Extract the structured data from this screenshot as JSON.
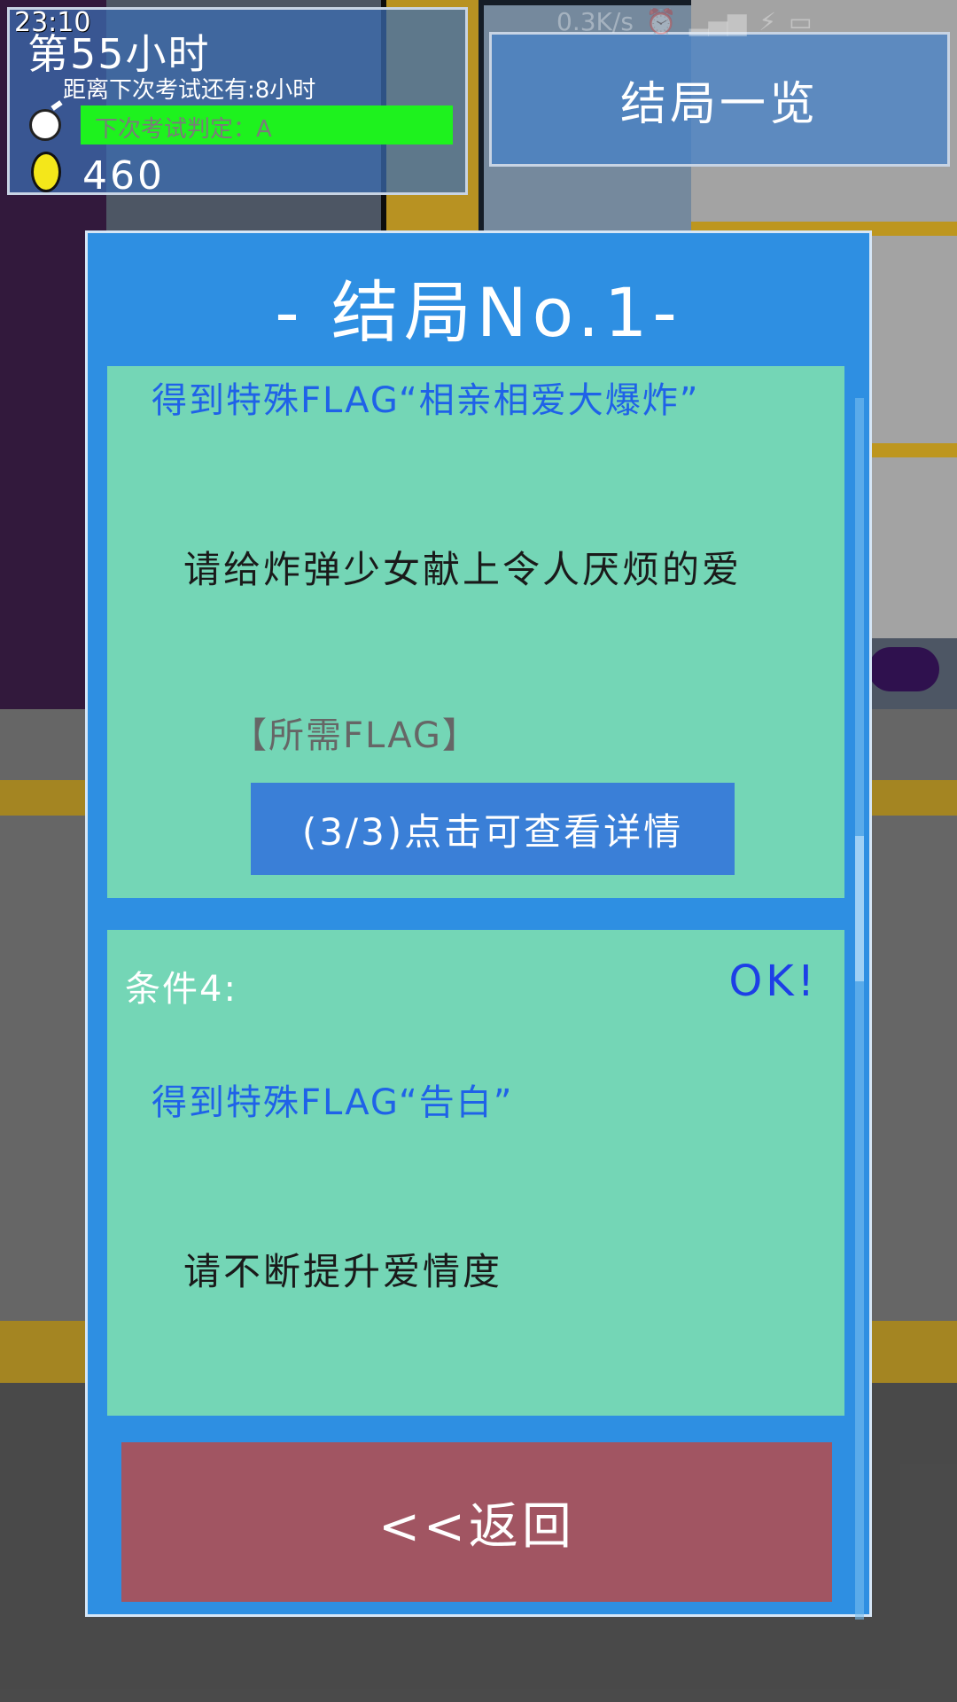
{
  "status_bar": {
    "time": "23:10",
    "network_speed": "0.3K/s",
    "icons": [
      "alarm-icon",
      "signal-icon",
      "charging-icon",
      "battery-icon"
    ]
  },
  "hud": {
    "hour_label": "第55小时",
    "countdown": "距离下次考试还有:8小时",
    "grade": "下次考试判定：A",
    "coins": "460",
    "colors": {
      "grade_bar": "#1ef21e",
      "coin": "#f4e71a"
    }
  },
  "header": {
    "ending_list_button": "结局一览"
  },
  "dialog": {
    "title": "- 结局No.1-",
    "condition_3": {
      "flag": "得到特殊FLAG“相亲相爱大爆炸”",
      "description": "请给炸弹少女献上令人厌烦的爱",
      "required_flag_label": "【所需FLAG】",
      "detail_button": "(3/3)点击可查看详情"
    },
    "condition_4": {
      "label": "条件4:",
      "status": "OK!",
      "flag": "得到特殊FLAG“告白”",
      "description": "请不断提升爱情度"
    },
    "back_button": "<<返回",
    "colors": {
      "panel": "#2e8fe2",
      "card": "#74d6b6",
      "back": "#a15562",
      "detail": "#3a7fd7"
    }
  }
}
